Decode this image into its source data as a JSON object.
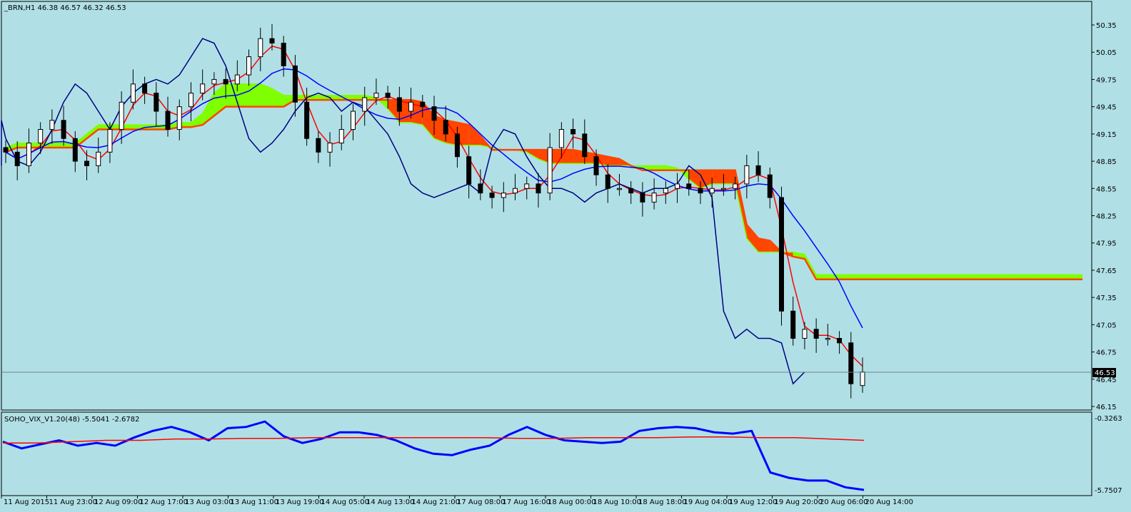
{
  "main_header": "_BRN,H1  46.38 46.57 46.32 46.53",
  "sub_header": "SOHO_VIX_V1.20(48) -5.5041 -2.6782",
  "current_price": "46.53",
  "price_axis_labels": [
    "50.35",
    "50.05",
    "49.75",
    "49.45",
    "49.15",
    "48.85",
    "48.55",
    "48.25",
    "47.95",
    "47.65",
    "47.35",
    "47.05",
    "46.75",
    "46.45",
    "46.15"
  ],
  "sub_axis_labels": [
    "-0.3263",
    "-5.7507"
  ],
  "time_labels": [
    "11 Aug 2015",
    "11 Aug 23:00",
    "12 Aug 09:00",
    "12 Aug 17:00",
    "13 Aug 03:00",
    "13 Aug 11:00",
    "13 Aug 19:00",
    "14 Aug 05:00",
    "14 Aug 13:00",
    "14 Aug 21:00",
    "17 Aug 08:00",
    "17 Aug 16:00",
    "18 Aug 00:00",
    "18 Aug 10:00",
    "18 Aug 18:00",
    "19 Aug 04:00",
    "19 Aug 12:00",
    "19 Aug 20:00",
    "20 Aug 06:00",
    "20 Aug 14:00"
  ],
  "colors": {
    "background": "#b0e0e6",
    "bull_cloud": "#7fff00",
    "bear_cloud": "#ff4500",
    "cloud_line": "#ff4500",
    "tenkan": "#ff0000",
    "kijun": "#0000ff",
    "chikou": "#000080",
    "vix_line": "#0000ff",
    "vix_signal": "#ff0000",
    "candle_bear": "#000000",
    "candle_bull": "#ffffff"
  },
  "chart_data": [
    {
      "type": "candlestick",
      "title": "_BRN,H1",
      "ylim": [
        46.05,
        50.45
      ],
      "last": {
        "open": 46.38,
        "high": 46.57,
        "low": 46.32,
        "close": 46.53
      },
      "close": [
        48.95,
        48.8,
        49.05,
        49.2,
        49.3,
        49.1,
        48.85,
        48.8,
        48.95,
        49.2,
        49.5,
        49.7,
        49.6,
        49.4,
        49.2,
        49.45,
        49.6,
        49.7,
        49.75,
        49.7,
        49.8,
        50.0,
        50.2,
        50.15,
        49.9,
        49.5,
        49.1,
        48.95,
        49.05,
        49.2,
        49.4,
        49.55,
        49.6,
        49.55,
        49.4,
        49.5,
        49.45,
        49.3,
        49.15,
        48.9,
        48.6,
        48.5,
        48.45,
        48.5,
        48.55,
        48.6,
        48.5,
        49.0,
        49.2,
        49.15,
        48.9,
        48.7,
        48.55,
        48.55,
        48.5,
        48.4,
        48.5,
        48.55,
        48.6,
        48.55,
        48.5,
        48.55,
        48.55,
        48.6,
        48.8,
        48.7,
        48.45,
        47.2,
        46.9,
        47.0,
        46.9,
        46.9,
        46.85,
        46.4,
        46.53
      ],
      "series": [
        {
          "name": "Tenkan",
          "values": []
        },
        {
          "name": "Kijun",
          "values": []
        }
      ]
    },
    {
      "type": "line",
      "title": "SOHO_VIX_V1.20(48)",
      "ylim": [
        -5.7507,
        -0.3263
      ],
      "series": [
        {
          "name": "VIX",
          "values": [
            -2.1,
            -2.6,
            -2.3,
            -2.0,
            -2.4,
            -2.2,
            -2.4,
            -1.8,
            -1.3,
            -1.0,
            -1.4,
            -2.0,
            -1.1,
            -1.0,
            -0.6,
            -1.7,
            -2.2,
            -1.9,
            -1.4,
            -1.4,
            -1.6,
            -2.0,
            -2.6,
            -3.0,
            -3.1,
            -2.7,
            -2.4,
            -1.6,
            -1.0,
            -1.6,
            -2.0,
            -2.1,
            -2.2,
            -2.1,
            -1.3,
            -1.1,
            -1.0,
            -1.1,
            -1.4,
            -1.5,
            -1.3,
            -4.4,
            -4.8,
            -5.0,
            -5.0,
            -5.5,
            -5.7
          ]
        },
        {
          "name": "Signal",
          "values": [
            -2.2,
            -2.2,
            -2.1,
            -2.0,
            -2.0,
            -1.9,
            -1.9,
            -1.85,
            -1.85,
            -1.8,
            -1.8,
            -1.8,
            -1.8,
            -1.8,
            -1.8,
            -1.85,
            -1.85,
            -1.8,
            -1.8,
            -1.8,
            -1.75,
            -1.75,
            -1.8,
            -1.8,
            -1.9,
            -2.0
          ]
        }
      ]
    }
  ]
}
